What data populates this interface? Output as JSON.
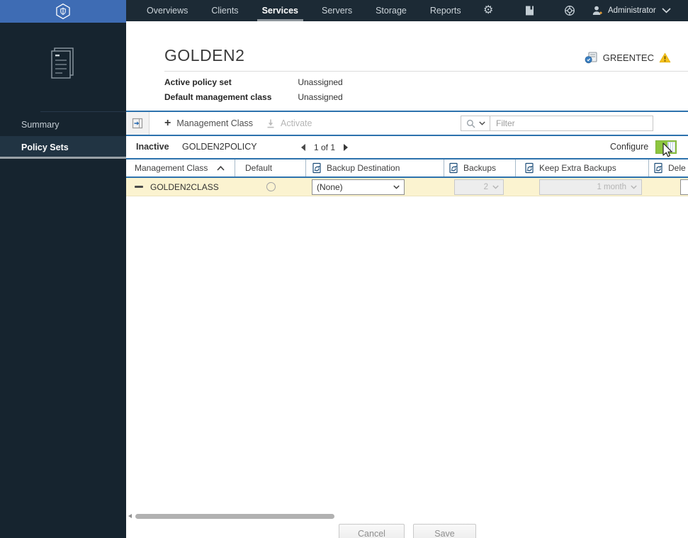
{
  "topnav": {
    "items": [
      "Overviews",
      "Clients",
      "Services",
      "Servers",
      "Storage",
      "Reports"
    ],
    "active_item": "Services",
    "user": "Administrator"
  },
  "sidebar": {
    "items": [
      {
        "label": "Summary",
        "active": false
      },
      {
        "label": "Policy Sets",
        "active": true
      }
    ]
  },
  "header": {
    "title": "GOLDEN2",
    "server": "GREENTEC",
    "fields": [
      {
        "label": "Active policy set",
        "value": "Unassigned"
      },
      {
        "label": "Default management class",
        "value": "Unassigned"
      }
    ]
  },
  "toolbar": {
    "add_label": "Management Class",
    "activate_label": "Activate",
    "filter_placeholder": "Filter"
  },
  "policy_bar": {
    "status": "Inactive",
    "name": "GOLDEN2POLICY",
    "pager": "1 of 1",
    "configure_label": "Configure",
    "configure_toggle_on": true
  },
  "table": {
    "columns": [
      {
        "label": "Management Class",
        "sorted": "asc",
        "icon": "none"
      },
      {
        "label": "Default",
        "icon": "none"
      },
      {
        "label": "Backup Destination",
        "icon": "backup-sync"
      },
      {
        "label": "Backups",
        "icon": "backup-sync"
      },
      {
        "label": "Keep Extra Backups",
        "icon": "backup-sync"
      },
      {
        "label": "Dele",
        "icon": "backup-sync"
      }
    ],
    "row": {
      "name": "GOLDEN2CLASS",
      "default_selected": false,
      "backup_destination": "(None)",
      "backups": "2",
      "keep_extra_backups": "1 month"
    }
  },
  "footer": {
    "cancel_label": "Cancel",
    "save_label": "Save"
  },
  "icons": {
    "brand": "hexagon-shield",
    "settings": "gear",
    "documentation": "book",
    "support": "help-ring",
    "user": "person-star",
    "sidebar_section": "policy-document",
    "panel": "open-panel-arrow",
    "search": "magnifier",
    "server_status": "server-shield",
    "alert": "warning-triangle",
    "pointer": "mouse-cursor"
  },
  "colors": {
    "nav_bg": "#1c2a35",
    "brand_blue": "#3e6cb4",
    "accent_line": "#2d72ad",
    "row_highlight": "#fbf3d0",
    "toggle_green": "#8dc63f",
    "warning_yellow": "#f6c21d"
  }
}
